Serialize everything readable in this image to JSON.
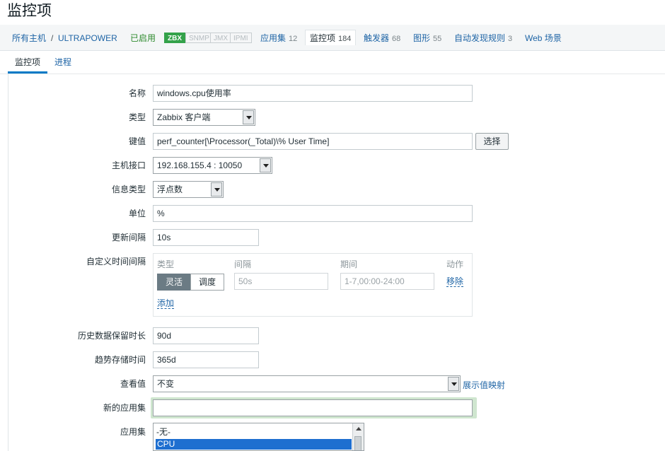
{
  "page": {
    "title": "监控项"
  },
  "nav": {
    "all_hosts": "所有主机",
    "separator": "/",
    "host": "ULTRAPOWER",
    "status": "已启用",
    "badges": {
      "zbx": "ZBX",
      "snmp": "SNMP",
      "jmx": "JMX",
      "ipmi": "IPMI"
    },
    "applications": {
      "label": "应用集",
      "count": "12"
    },
    "items": {
      "label": "监控项",
      "count": "184"
    },
    "triggers": {
      "label": "触发器",
      "count": "68"
    },
    "graphs": {
      "label": "图形",
      "count": "55"
    },
    "discovery": {
      "label": "自动发现规则",
      "count": "3"
    },
    "web": {
      "label": "Web 场景"
    }
  },
  "tabs": {
    "item": "监控项",
    "process": "进程"
  },
  "form": {
    "name": {
      "label": "名称",
      "value": "windows.cpu使用率"
    },
    "type": {
      "label": "类型",
      "value": "Zabbix 客户端"
    },
    "key": {
      "label": "键值",
      "value": "perf_counter[\\Processor(_Total)\\% User Time]",
      "button": "选择"
    },
    "interface": {
      "label": "主机接口",
      "value": "192.168.155.4 : 10050"
    },
    "info_type": {
      "label": "信息类型",
      "value": "浮点数"
    },
    "units": {
      "label": "单位",
      "value": "%"
    },
    "update_interval": {
      "label": "更新间隔",
      "value": "10s"
    },
    "custom_intervals": {
      "label": "自定义时间间隔",
      "headers": {
        "type": "类型",
        "interval": "间隔",
        "period": "期间",
        "action": "动作"
      },
      "flexible": "灵活",
      "scheduling": "调度",
      "interval_placeholder": "50s",
      "period_placeholder": "1-7,00:00-24:00",
      "remove": "移除",
      "add": "添加"
    },
    "history": {
      "label": "历史数据保留时长",
      "value": "90d"
    },
    "trends": {
      "label": "趋势存储时间",
      "value": "365d"
    },
    "valuemap": {
      "label": "查看值",
      "value": "不变",
      "link": "展示值映射"
    },
    "new_application": {
      "label": "新的应用集",
      "value": ""
    },
    "applications": {
      "label": "应用集",
      "options": [
        "-无-",
        "CPU"
      ],
      "selected": "CPU"
    }
  },
  "colors": {
    "link": "#1f65a6",
    "enabled": "#2e8b2e",
    "zbx_badge": "#34a24a",
    "selected_option": "#1e6fd0",
    "tab_underline": "#0079c6"
  }
}
